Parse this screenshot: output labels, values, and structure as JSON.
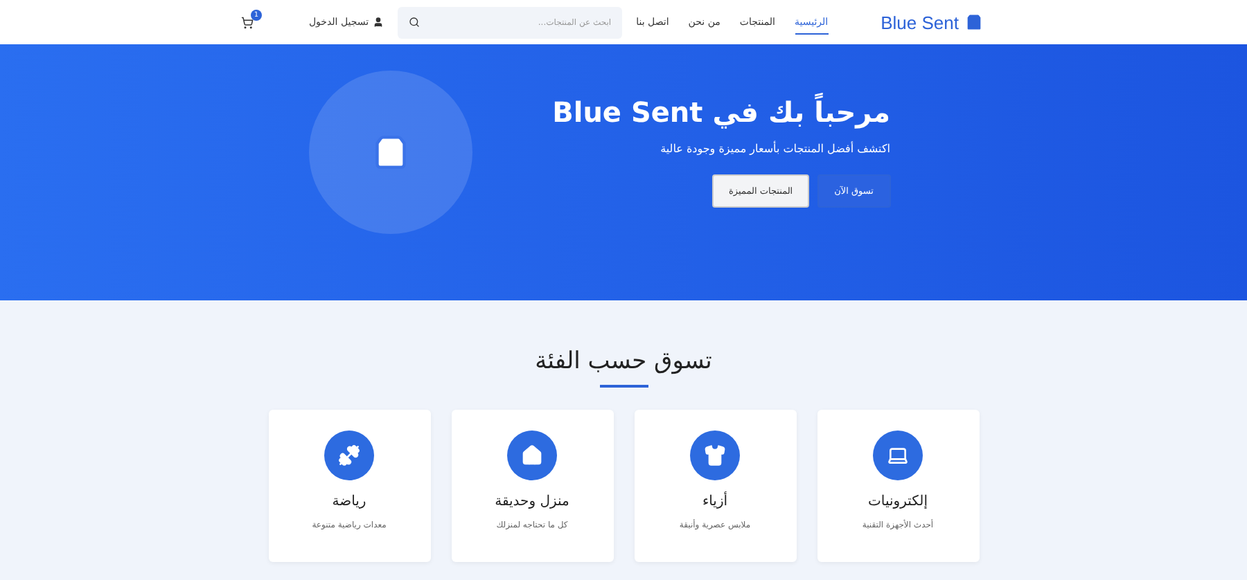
{
  "header": {
    "brand": "Blue Sent",
    "nav": [
      {
        "label": "الرئيسية",
        "selected": true
      },
      {
        "label": "المنتجات",
        "selected": false
      },
      {
        "label": "من نحن",
        "selected": false
      },
      {
        "label": "اتصل بنا",
        "selected": false
      }
    ],
    "search": {
      "placeholder": "ابحث عن المنتجات..."
    },
    "login": "تسجيل الدخول",
    "cart_count": "1"
  },
  "hero": {
    "title": "مرحباً بك في Blue Sent",
    "subtitle": "اكتشف أفضل المنتجات بأسعار مميزة وجودة عالية",
    "buttons": [
      {
        "label": "تسوق الآن",
        "kind": "primary"
      },
      {
        "label": "المنتجات المميزة",
        "kind": "light"
      }
    ]
  },
  "categories": {
    "heading": "تسوق حسب الفئة",
    "items": [
      {
        "kind": "laptop",
        "title": "إلكترونيات",
        "subtitle": "أحدث الأجهزة التقنية"
      },
      {
        "kind": "shirt",
        "title": "أزياء",
        "subtitle": "ملابس عصرية وأنيقة"
      },
      {
        "kind": "home",
        "title": "منزل وحديقة",
        "subtitle": "كل ما تحتاجه لمنزلك"
      },
      {
        "kind": "dumbbell",
        "title": "رياضة",
        "subtitle": "معدات رياضية متنوعة"
      }
    ]
  }
}
